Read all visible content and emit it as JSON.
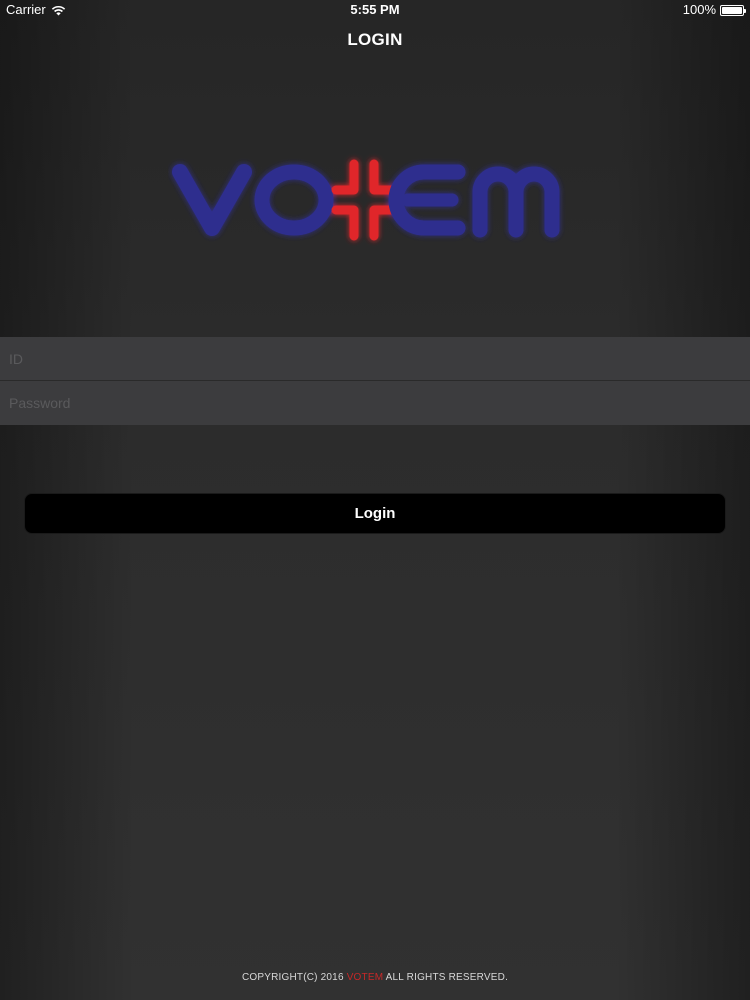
{
  "status_bar": {
    "carrier": "Carrier",
    "time": "5:55 PM",
    "battery_percent": "100%",
    "battery_level": 1.0,
    "wifi_icon": "wifi-icon",
    "battery_icon": "battery-icon"
  },
  "nav": {
    "title": "LOGIN"
  },
  "logo": {
    "text": "VOTEM",
    "colors": {
      "letters": "#2f2f8e",
      "cross": "#e0262a",
      "glow": "#6b6bd6"
    }
  },
  "form": {
    "id_placeholder": "ID",
    "password_placeholder": "Password",
    "login_label": "Login"
  },
  "footer": {
    "prefix": "COPYRIGHT(C) 2016 ",
    "brand": "VOTEM",
    "suffix": " ALL RIGHTS RESERVED."
  },
  "colors": {
    "background": "#2a2a2a",
    "field_background": "#3c3c3e",
    "button_background": "#000000",
    "brand_red": "#c62828"
  }
}
